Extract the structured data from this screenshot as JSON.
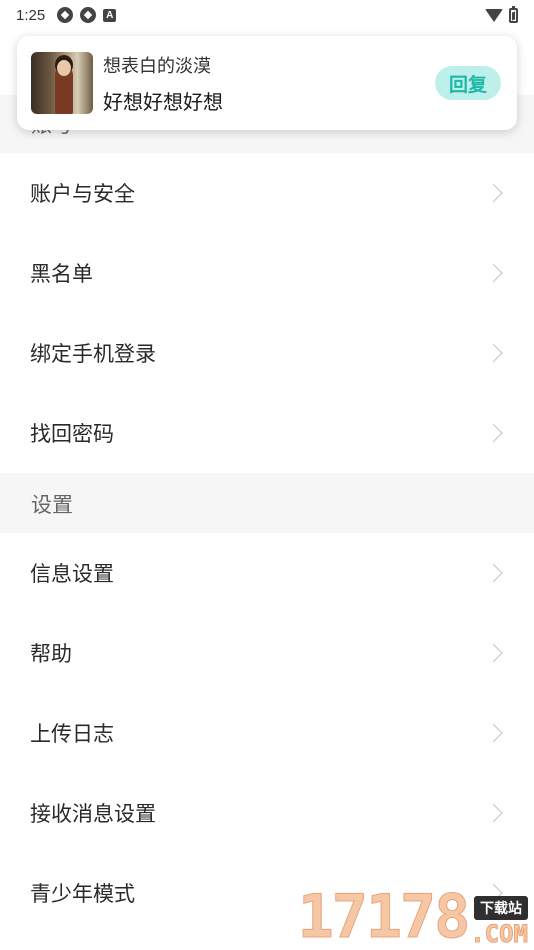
{
  "status_bar": {
    "time": "1:25",
    "left_icons": [
      "app-icon",
      "app-icon",
      "a-icon"
    ],
    "right_icons": [
      "wifi-icon",
      "battery-icon"
    ]
  },
  "notification": {
    "sender": "想表白的淡漠",
    "message": "好想好想好想",
    "reply_label": "回复",
    "reply_bg": "#bdf0ea",
    "reply_color": "#1fb8a8"
  },
  "sections": {
    "account": {
      "label": "账号",
      "items": [
        {
          "label": "账户与安全"
        },
        {
          "label": "黑名单"
        },
        {
          "label": "绑定手机登录"
        },
        {
          "label": "找回密码"
        }
      ]
    },
    "settings": {
      "label": "设置",
      "items": [
        {
          "label": "信息设置"
        },
        {
          "label": "帮助"
        },
        {
          "label": "上传日志"
        },
        {
          "label": "接收消息设置"
        },
        {
          "label": "青少年模式"
        }
      ]
    }
  },
  "watermark": {
    "digits": "17178",
    "tag": "下载站",
    "suffix": ".COM"
  }
}
